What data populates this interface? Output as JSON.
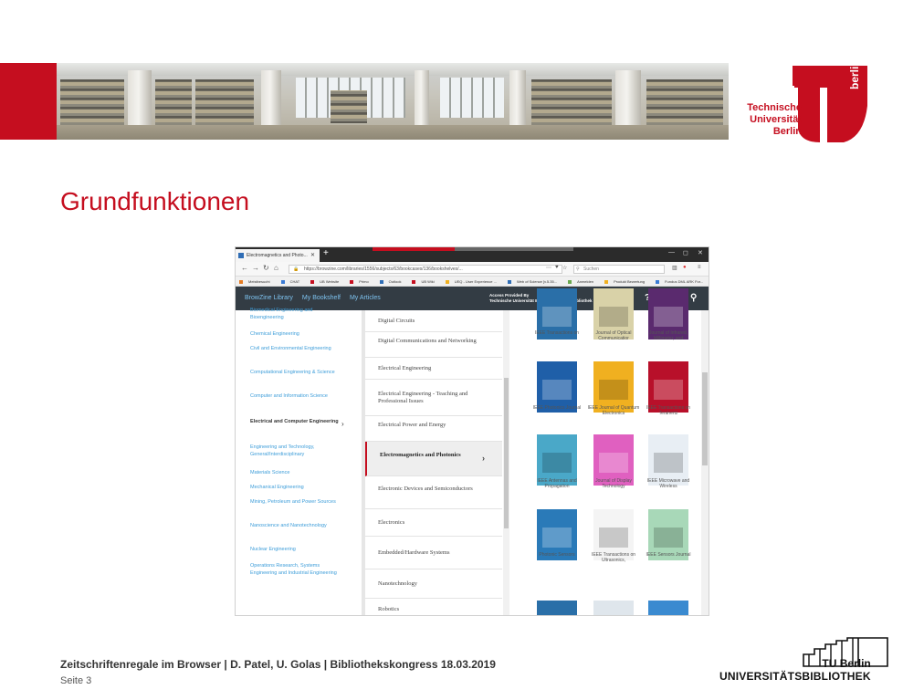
{
  "slide": {
    "title": "Grundfunktionen",
    "footer": "Zeitschriftenregale im Browser | D. Patel, U. Golas | Bibliothekskongress 18.03.2019",
    "page": "Seite 3",
    "accent_color": "#c50e1f"
  },
  "logo": {
    "line1": "Technische",
    "line2": "Universität",
    "line3": "Berlin",
    "vertical": "berlin"
  },
  "ub_logo": {
    "line1": "TU Berlin",
    "line2": "UNIVERSITÄTSBIBLIOTHEK"
  },
  "browser": {
    "tab_title": "Electromagnetics and Photo...",
    "url": "https://browzine.com/libraries/1556/subjects/63/bookcases/136/bookshelves/...",
    "search_placeholder": "Suchen",
    "bookmarks": [
      "Meistbesucht",
      "CHAT",
      "UB Website",
      "Primo",
      "Outlook",
      "UB Wiki",
      "UEQ - User Experience ...",
      "Web of Science [v.5.35...",
      "Anmelden",
      "Produkt Bewertung",
      "Fundus DML ARK For...",
      "Wiki"
    ]
  },
  "app": {
    "nav": [
      "BrowZine Library",
      "My Bookshelf",
      "My Articles"
    ],
    "access_label": "Access Provided By",
    "access_org": "Technische Universität Berlin, Universitätsbibliothek"
  },
  "subjects": [
    "Biomedical Engineering and Bioengineering",
    "Chemical Engineering",
    "Civil and Environmental Engineering",
    "Computational Engineering & Science",
    "Computer and Information Science",
    "Electrical and Computer Engineering",
    "Engineering and Technology, General/Interdisciplinary",
    "Materials Science",
    "Mechanical Engineering",
    "Mining, Petroleum and Power Sources",
    "Nanoscience and Nanotechnology",
    "Nuclear Engineering",
    "Operations Research, Systems Engineering and Industrial Engineering"
  ],
  "active_subject": "Electrical and Computer Engineering",
  "categories": [
    "Digital Circuits",
    "Digital Communications and Networking",
    "Electrical Engineering",
    "Electrical Engineering - Teaching and Professional Issues",
    "Electrical Power and Energy",
    "Electromagnetics and Photonics",
    "Electronic Devices and Semiconductors",
    "Electronics",
    "Embedded/Hardware Systems",
    "Nanotechnology",
    "Robotics"
  ],
  "active_category": "Electromagnetics and Photonics",
  "journals": [
    {
      "label": "IEEE Transactions on",
      "color": "#2a6fa8"
    },
    {
      "label": "Journal of Optical Communicatior",
      "color": "#d9d2a8"
    },
    {
      "label": "Journal of Infrared, Millimeter, and",
      "color": "#5a2a6e"
    },
    {
      "label": "IEEE Photonics Journal",
      "color": "#1f5fa8"
    },
    {
      "label": "IEEE Journal of Quantum Electronics",
      "color": "#f0b020"
    },
    {
      "label": "IEEE Transactions on Terahertz",
      "color": "#b8102a"
    },
    {
      "label": "IEEE Antennas and Propagation",
      "color": "#4aa8c8"
    },
    {
      "label": "Journal of Display Technology",
      "color": "#e060c0"
    },
    {
      "label": "IEEE Microwave and Wireless",
      "color": "#e8eef4"
    },
    {
      "label": "Photonic Sensors",
      "color": "#2a7ab8"
    },
    {
      "label": "IEEE Transactions on Ultrasonics,",
      "color": "#f4f4f4"
    },
    {
      "label": "IEEE Sensors Journal",
      "color": "#a8d8b8"
    }
  ]
}
